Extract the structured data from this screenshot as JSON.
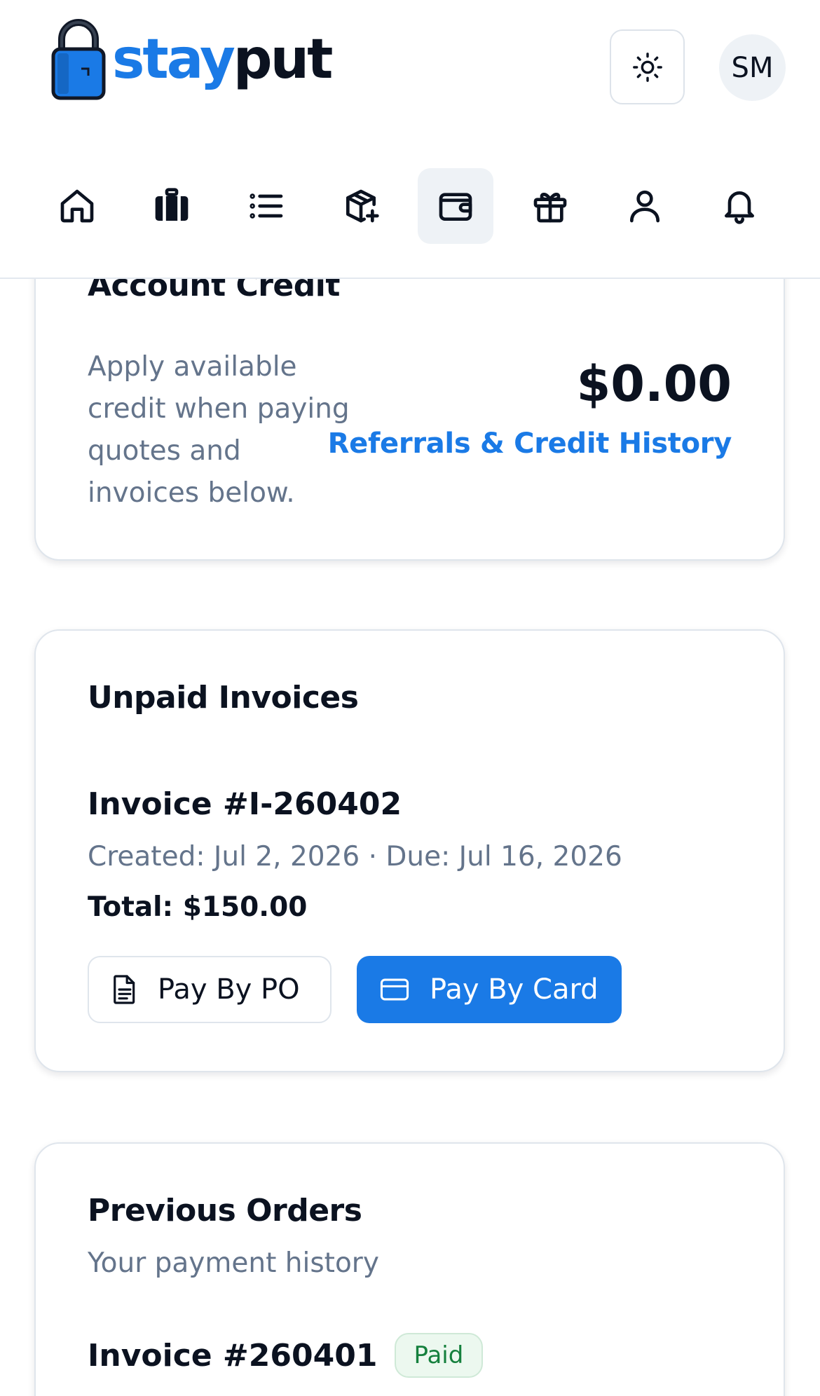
{
  "brand": {
    "part1": "stay",
    "part2": "put"
  },
  "header": {
    "avatar_initials": "SM",
    "theme_icon": "sun-icon"
  },
  "nav": {
    "items": [
      {
        "name": "home",
        "icon": "home-icon"
      },
      {
        "name": "storage",
        "icon": "luggage-icon"
      },
      {
        "name": "list",
        "icon": "list-icon"
      },
      {
        "name": "order-supplies",
        "icon": "box-plus-icon"
      },
      {
        "name": "billing",
        "icon": "wallet-icon",
        "active": true
      },
      {
        "name": "referrals",
        "icon": "gift-icon"
      },
      {
        "name": "profile",
        "icon": "user-icon"
      },
      {
        "name": "notifications",
        "icon": "bell-icon"
      }
    ]
  },
  "credit": {
    "title": "Account Credit",
    "description": "Apply available credit when paying quotes and invoices below.",
    "amount": "$0.00",
    "link": "Referrals & Credit History"
  },
  "unpaid": {
    "title": "Unpaid Invoices",
    "invoice_number": "Invoice #I-260402",
    "dates": "Created: Jul 2, 2026 · Due: Jul 16, 2026",
    "total": "Total: $150.00",
    "pay_po_label": "Pay By PO",
    "pay_card_label": "Pay By Card"
  },
  "previous": {
    "title": "Previous Orders",
    "subtitle": "Your payment history",
    "order_number": "Invoice #260401",
    "status": "Paid"
  },
  "colors": {
    "accent": "#1a7ae6",
    "paid_text": "#15803d",
    "muted_text": "#64748b"
  }
}
